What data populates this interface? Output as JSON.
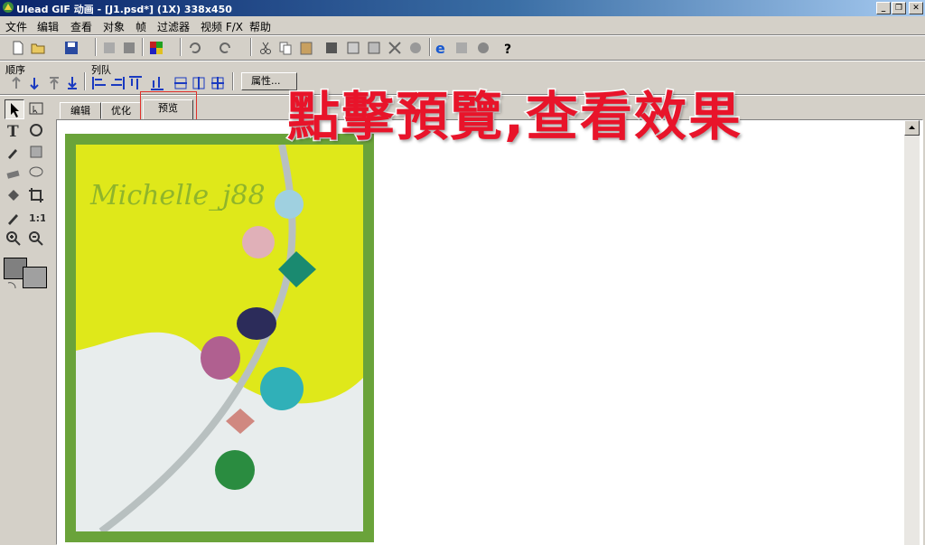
{
  "window": {
    "title": "Ulead GIF 动画 - [J1.psd*] (1X) 338x450",
    "controls": [
      "minimize",
      "restore",
      "close"
    ]
  },
  "menu": [
    {
      "label": "文件"
    },
    {
      "label": "编辑"
    },
    {
      "label": "查看"
    },
    {
      "label": "对象"
    },
    {
      "label": "帧"
    },
    {
      "label": "过滤器"
    },
    {
      "label": "视频 F/X"
    },
    {
      "label": "帮助"
    }
  ],
  "toolbar2": {
    "order_label": "顺序",
    "queue_label": "列队",
    "properties_label": "属性..."
  },
  "tabs": [
    {
      "label": "编辑"
    },
    {
      "label": "优化"
    },
    {
      "label": "预览"
    }
  ],
  "active_tab": "预览",
  "canvas": {
    "watermark": "Michelle_j88",
    "frame_color": "#6aa33a",
    "bg_yellow": "#dfe81a"
  },
  "annotation": {
    "text": "點擊預覽,查看效果",
    "color": "#e8142a"
  }
}
